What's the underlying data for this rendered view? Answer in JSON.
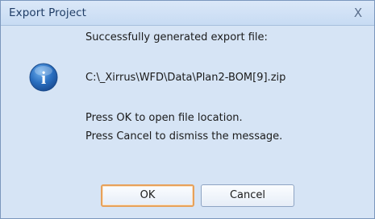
{
  "window": {
    "title": "Export Project",
    "close_glyph": "X"
  },
  "message": {
    "line1": "Successfully generated export file:",
    "path": "C:\\_Xirrus\\WFD\\Data\\Plan2-BOM[9].zip",
    "line3": "Press OK to open file location.",
    "line4": "Press Cancel to dismiss the message."
  },
  "buttons": {
    "ok_label": "OK",
    "cancel_label": "Cancel"
  },
  "icon": {
    "name": "info-icon",
    "glyph": "i",
    "color": "#2a6fc0"
  },
  "colors": {
    "dialog_bg": "#d6e4f5",
    "default_button_border": "#e7a15a"
  }
}
